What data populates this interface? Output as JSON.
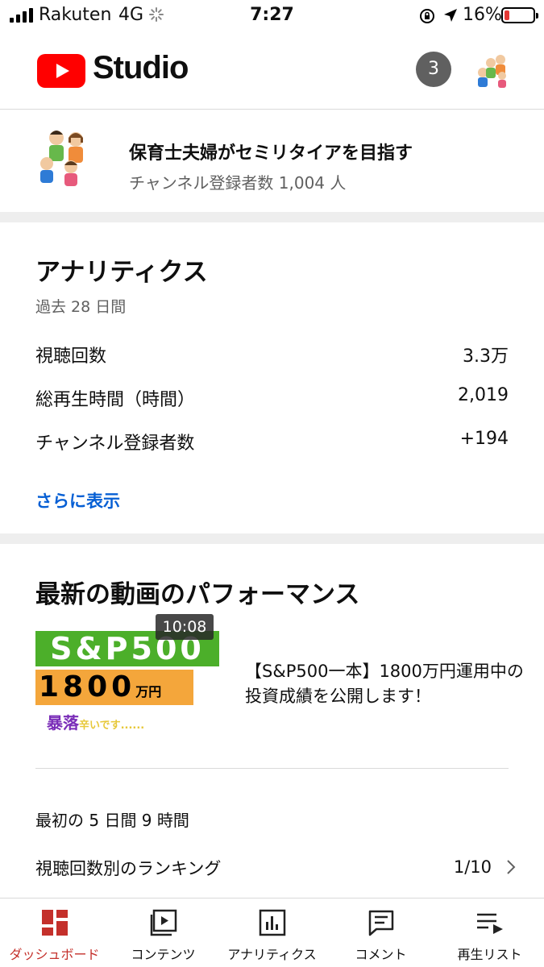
{
  "status_bar": {
    "carrier": "Rakuten",
    "network": "4G",
    "time": "7:27",
    "battery_percent": "16%",
    "battery_color": "#e53935"
  },
  "header": {
    "logo_text": "Studio",
    "logo_color": "#ff0000",
    "notification_count": "3",
    "icons": [
      "youtube-play-icon",
      "account-avatar-icon"
    ]
  },
  "channel": {
    "name": "保育士夫婦がセミリタイアを目指す",
    "subscribers": "チャンネル登録者数 1,004 人"
  },
  "analytics": {
    "title": "アナリティクス",
    "period": "過去 28 日間",
    "metrics": [
      {
        "label": "視聴回数",
        "value": "3.3万"
      },
      {
        "label": "総再生時間（時間）",
        "value": "2,019"
      },
      {
        "label": "チャンネル登録者数",
        "value": "+194"
      }
    ],
    "more_link": "さらに表示",
    "link_color": "#065fd4"
  },
  "latest_video": {
    "section_title": "最新の動画のパフォーマンス",
    "thumbnail": {
      "line1": "S&P500",
      "line2": "1800",
      "line2_unit": "万円",
      "line3": "暴落",
      "line3_small": "辛いです......"
    },
    "duration": "10:08",
    "title": "【S&P500一本】1800万円運用中の投資成績を公開します！",
    "first_period": "最初の 5 日間 9 時間",
    "ranking_label": "視聴回数別のランキング",
    "ranking_value": "1/10"
  },
  "bottom_nav": {
    "active_color": "#c4302b",
    "items": [
      {
        "label": "ダッシュボード",
        "icon": "dashboard-icon"
      },
      {
        "label": "コンテンツ",
        "icon": "content-icon"
      },
      {
        "label": "アナリティクス",
        "icon": "analytics-icon"
      },
      {
        "label": "コメント",
        "icon": "comment-icon"
      },
      {
        "label": "再生リスト",
        "icon": "playlist-icon"
      }
    ]
  }
}
